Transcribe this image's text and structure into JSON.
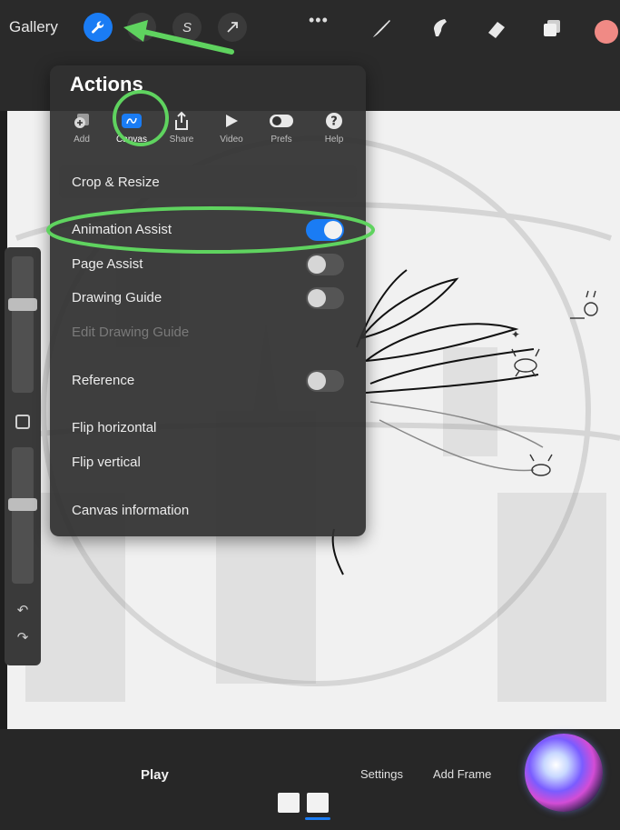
{
  "toolbar": {
    "gallery_label": "Gallery",
    "more_label": "•••"
  },
  "actions_panel": {
    "title": "Actions",
    "tabs": [
      {
        "label": "Add",
        "icon": "add-layer-icon"
      },
      {
        "label": "Canvas",
        "icon": "canvas-icon"
      },
      {
        "label": "Share",
        "icon": "share-icon"
      },
      {
        "label": "Video",
        "icon": "video-play-icon"
      },
      {
        "label": "Prefs",
        "icon": "toggle-prefs-icon"
      },
      {
        "label": "Help",
        "icon": "help-icon"
      }
    ],
    "active_tab": "Canvas",
    "items": {
      "crop_resize": "Crop & Resize",
      "animation_assist": "Animation Assist",
      "page_assist": "Page Assist",
      "drawing_guide": "Drawing Guide",
      "edit_drawing_guide": "Edit Drawing Guide",
      "reference": "Reference",
      "flip_horizontal": "Flip horizontal",
      "flip_vertical": "Flip vertical",
      "canvas_information": "Canvas information"
    },
    "toggles": {
      "animation_assist": true,
      "page_assist": false,
      "drawing_guide": false,
      "reference": false
    }
  },
  "bottom_bar": {
    "play_label": "Play",
    "settings_label": "Settings",
    "add_frame_label": "Add Frame"
  },
  "colors": {
    "accent": "#1a7cf4",
    "annotation_green": "#5fd35f",
    "current_color": "#f08a85"
  }
}
